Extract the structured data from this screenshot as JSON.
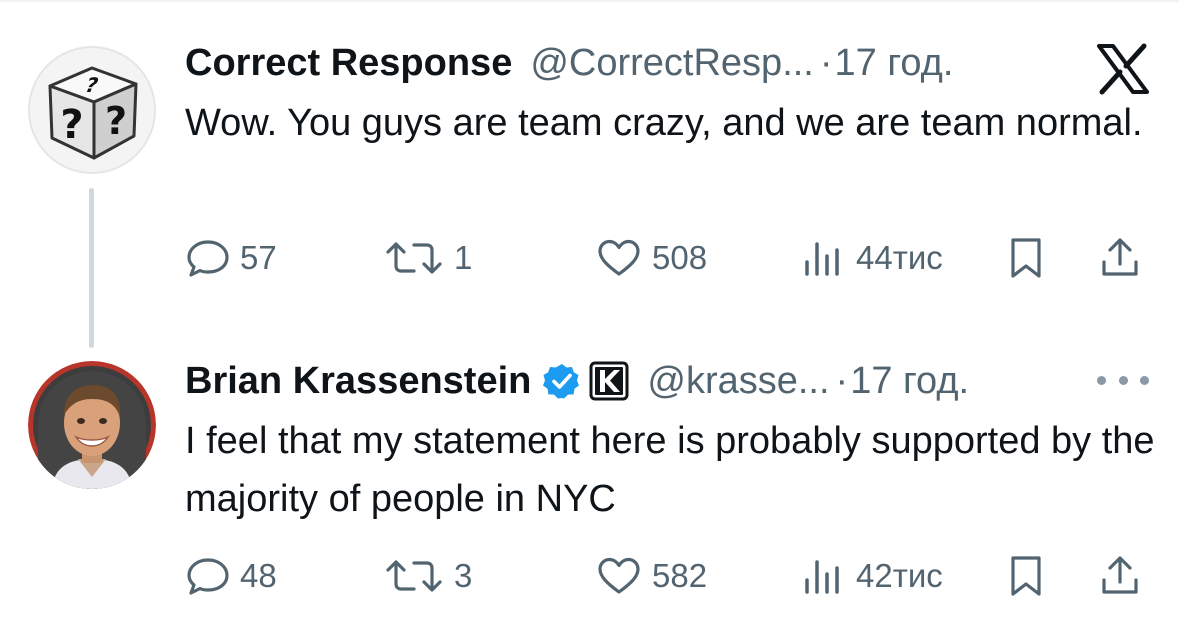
{
  "tweets": [
    {
      "display_name": "Correct Response",
      "handle": "@CorrectResp...",
      "separator": "·",
      "time": "17 год.",
      "text": "Wow. You guys are team crazy, and we are team normal.",
      "avatar": "question-mark-cube",
      "stats": {
        "replies": "57",
        "reposts": "1",
        "likes": "508",
        "views": "44тис"
      }
    },
    {
      "display_name": "Brian Krassenstein",
      "handle": "@krasse...",
      "separator": "·",
      "time": "17 год.",
      "text": "I feel that my statement here is probably supported by the majority of people in NYC",
      "avatar": "profile-photo",
      "verified": true,
      "affiliate_badge": "K",
      "stats": {
        "replies": "48",
        "reposts": "3",
        "likes": "582",
        "views": "42тис"
      }
    }
  ],
  "icons": {
    "reply": "speech-bubble-icon",
    "repost": "repost-icon",
    "like": "heart-icon",
    "views": "bar-chart-icon",
    "bookmark": "bookmark-icon",
    "share": "share-icon",
    "brand": "x-logo-icon",
    "more": "more-dots-icon"
  },
  "colors": {
    "text": "#0f1419",
    "secondary": "#536471",
    "verified": "#1d9bf0",
    "thread_line": "#cfd9de"
  }
}
